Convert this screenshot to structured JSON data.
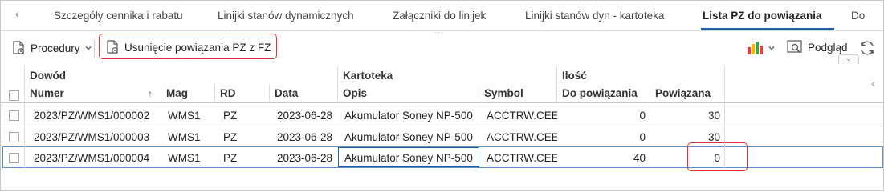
{
  "tabs": {
    "items": [
      {
        "label": "Szczegóły cennika i rabatu"
      },
      {
        "label": "Linijki stanów dynamicznych"
      },
      {
        "label": "Załączniki do linijek"
      },
      {
        "label": "Linijki stanów dyn - kartoteka"
      },
      {
        "label": "Lista PZ do powiązania"
      },
      {
        "label": "Do"
      }
    ],
    "active_index": 4,
    "nav_prev": "‹"
  },
  "toolbar": {
    "procedures_label": "Procedury",
    "unlink_label": "Usunięcie powiązania PZ z FZ",
    "preview_label": "Podgląd",
    "highlight_color": "#e23030"
  },
  "grid": {
    "group_headers": {
      "dowod": "Dowód",
      "kartoteka": "Kartoteka",
      "ilosc": "Ilość"
    },
    "columns": {
      "numer": "Numer",
      "mag": "Mag",
      "rd": "RD",
      "data": "Data",
      "opis": "Opis",
      "symbol": "Symbol",
      "do_powiazania": "Do powiązania",
      "powiazana": "Powiązana"
    },
    "rows": [
      {
        "numer": "2023/PZ/WMS1/000002",
        "mag": "WMS1",
        "rd": "PZ",
        "data": "2023-06-28",
        "opis": "Akumulator Soney NP-500",
        "symbol": "ACCTRW.CEE",
        "do_powiazania": "0",
        "powiazana": "30"
      },
      {
        "numer": "2023/PZ/WMS1/000003",
        "mag": "WMS1",
        "rd": "PZ",
        "data": "2023-06-28",
        "opis": "Akumulator Soney NP-500",
        "symbol": "ACCTRW.CEE",
        "do_powiazania": "0",
        "powiazana": "30"
      },
      {
        "numer": "2023/PZ/WMS1/000004",
        "mag": "WMS1",
        "rd": "PZ",
        "data": "2023-06-28",
        "opis": "Akumulator Soney NP-500",
        "symbol": "ACCTRW.CEE",
        "do_powiazania": "40",
        "powiazana": "0"
      }
    ],
    "selected_row_index": 2,
    "sort_indicator": "↑"
  },
  "colors": {
    "accent": "#1f5ea8",
    "highlight": "#e23030"
  }
}
